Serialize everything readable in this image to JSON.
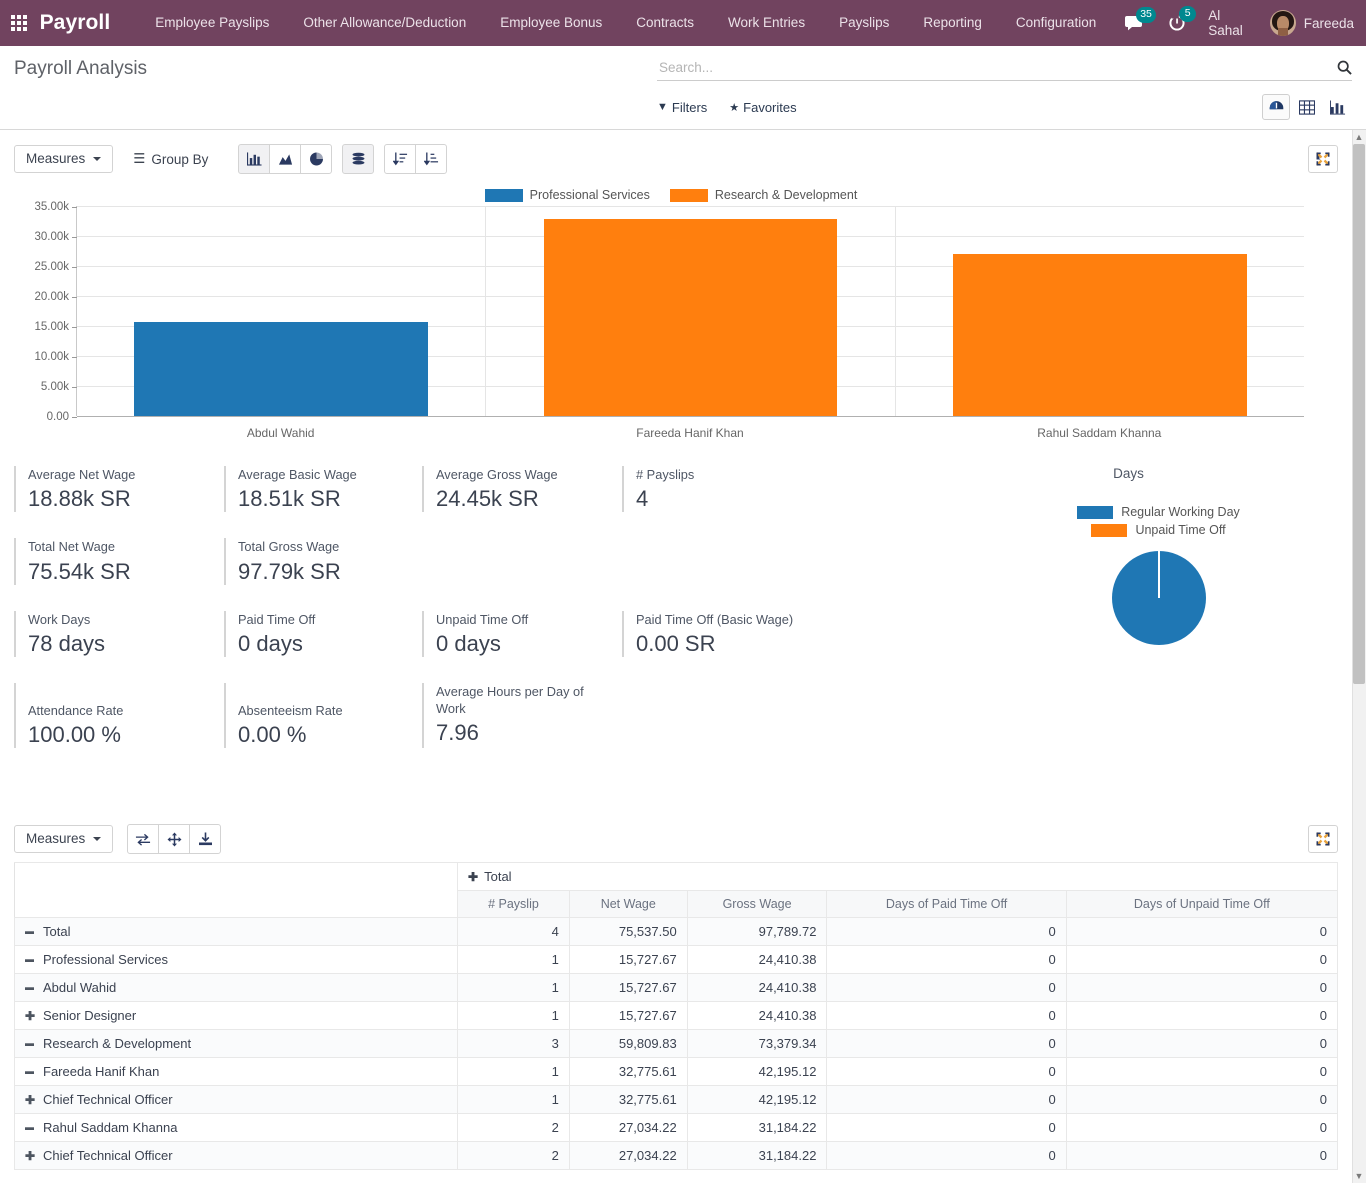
{
  "navbar": {
    "apps_icon": "apps-grid-icon",
    "brand": "Payroll",
    "menu": [
      {
        "label": "Employee Payslips"
      },
      {
        "label": "Other Allowance/Deduction"
      },
      {
        "label": "Employee Bonus"
      },
      {
        "label": "Contracts"
      },
      {
        "label": "Work Entries"
      },
      {
        "label": "Payslips"
      },
      {
        "label": "Reporting"
      },
      {
        "label": "Configuration"
      }
    ],
    "messages_badge": "35",
    "activities_badge": "5",
    "company": "Al Sahal",
    "user": "Fareeda",
    "bg_color": "#71435f"
  },
  "control_panel": {
    "breadcrumb": "Payroll Analysis",
    "search_placeholder": "Search...",
    "search_value": "",
    "filters_label": "Filters",
    "favorites_label": "Favorites",
    "views": [
      {
        "name": "dashboard",
        "active": true
      },
      {
        "name": "list",
        "active": false
      },
      {
        "name": "graph",
        "active": false
      }
    ]
  },
  "graph_toolbar": {
    "measures_label": "Measures",
    "group_by_label": "Group By",
    "chart_types": [
      {
        "name": "bar-chart-icon",
        "active": true
      },
      {
        "name": "line-chart-icon",
        "active": false
      },
      {
        "name": "pie-chart-icon",
        "active": false
      }
    ],
    "stacked_label": "stacked-icon",
    "stacked_active": true,
    "sort_asc_label": "sort-ascending-icon",
    "sort_desc_label": "sort-descending-icon",
    "expand_label": "expand-icon"
  },
  "chart_data": [
    {
      "type": "bar",
      "title": "",
      "categories": [
        "Abdul  Wahid",
        "Fareeda Hanif Khan",
        "Rahul Saddam Khanna"
      ],
      "series": [
        {
          "name": "Professional Services",
          "color": "#1f77b4",
          "values": [
            15727.67,
            0,
            0
          ]
        },
        {
          "name": "Research & Development",
          "color": "#ff7f0e",
          "values": [
            0,
            32775.61,
            27034.22
          ]
        }
      ],
      "legend": [
        "Professional Services",
        "Research & Development"
      ],
      "legend_position": "top",
      "ylim": [
        0,
        35000
      ],
      "yticks": [
        "0.00",
        "5.00k",
        "10.00k",
        "15.00k",
        "20.00k",
        "25.00k",
        "30.00k",
        "35.00k"
      ],
      "ytick_values": [
        0,
        5000,
        10000,
        15000,
        20000,
        25000,
        30000,
        35000
      ],
      "xlabel": "",
      "ylabel": "",
      "grid": true
    },
    {
      "type": "pie",
      "title": "Days",
      "labels": [
        "Regular Working Day",
        "Unpaid Time Off"
      ],
      "values": [
        78,
        0
      ],
      "colors": [
        "#1f77b4",
        "#ff7f0e"
      ],
      "legend_position": "top"
    }
  ],
  "kpis": {
    "row1": [
      {
        "label": "Average Net Wage",
        "value": "18.88k SR"
      },
      {
        "label": "Average Basic Wage",
        "value": "18.51k SR"
      },
      {
        "label": "Average Gross Wage",
        "value": "24.45k SR"
      },
      {
        "label": "# Payslips",
        "value": "4"
      }
    ],
    "row2": [
      {
        "label": "Total Net Wage",
        "value": "75.54k SR"
      },
      {
        "label": "Total Gross Wage",
        "value": "97.79k SR"
      }
    ],
    "row3": [
      {
        "label": "Work Days",
        "value": "78 days"
      },
      {
        "label": "Paid Time Off",
        "value": "0 days"
      },
      {
        "label": "Unpaid Time Off",
        "value": "0 days"
      },
      {
        "label": "Paid Time Off (Basic Wage)",
        "value": "0.00 SR"
      }
    ],
    "row4": [
      {
        "label": "Attendance Rate",
        "value": "100.00 %"
      },
      {
        "label": "Absenteeism Rate",
        "value": "0.00 %"
      },
      {
        "label": "Average Hours per Day of Work",
        "value": "7.96"
      }
    ]
  },
  "pivot": {
    "measures_label": "Measures",
    "flip_axis_label": "flip-axis-icon",
    "expand_all_label": "expand-all-icon",
    "download_label": "download-xlsx-icon",
    "expand_label": "expand-icon",
    "col_group_header": "Total",
    "columns": [
      "# Payslip",
      "Net Wage",
      "Gross Wage",
      "Days of Paid Time Off",
      "Days of Unpaid Time Off"
    ],
    "rows": [
      {
        "label": "Total",
        "indent": 0,
        "toggle": "minus",
        "values": [
          "4",
          "75,537.50",
          "97,789.72",
          "0",
          "0"
        ]
      },
      {
        "label": "Professional Services",
        "indent": 1,
        "toggle": "minus",
        "values": [
          "1",
          "15,727.67",
          "24,410.38",
          "0",
          "0"
        ]
      },
      {
        "label": "Abdul Wahid",
        "indent": 2,
        "toggle": "minus",
        "values": [
          "1",
          "15,727.67",
          "24,410.38",
          "0",
          "0"
        ]
      },
      {
        "label": "Senior Designer",
        "indent": 3,
        "toggle": "plus",
        "values": [
          "1",
          "15,727.67",
          "24,410.38",
          "0",
          "0"
        ]
      },
      {
        "label": "Research & Development",
        "indent": 1,
        "toggle": "minus",
        "values": [
          "3",
          "59,809.83",
          "73,379.34",
          "0",
          "0"
        ]
      },
      {
        "label": "Fareeda Hanif Khan",
        "indent": 2,
        "toggle": "minus",
        "values": [
          "1",
          "32,775.61",
          "42,195.12",
          "0",
          "0"
        ]
      },
      {
        "label": "Chief Technical Officer",
        "indent": 3,
        "toggle": "plus",
        "values": [
          "1",
          "32,775.61",
          "42,195.12",
          "0",
          "0"
        ]
      },
      {
        "label": "Rahul Saddam Khanna",
        "indent": 2,
        "toggle": "minus",
        "values": [
          "2",
          "27,034.22",
          "31,184.22",
          "0",
          "0"
        ]
      },
      {
        "label": "Chief Technical Officer",
        "indent": 3,
        "toggle": "plus",
        "values": [
          "2",
          "27,034.22",
          "31,184.22",
          "0",
          "0"
        ]
      }
    ]
  }
}
